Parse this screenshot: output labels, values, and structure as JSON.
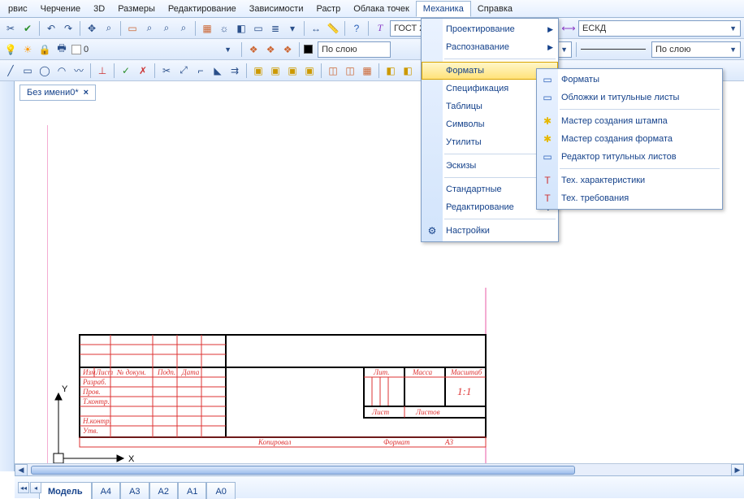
{
  "menu": {
    "items": [
      "рвис",
      "Черчение",
      "3D",
      "Размеры",
      "Редактирование",
      "Зависимости",
      "Растр",
      "Облака точек",
      "Механика",
      "Справка"
    ],
    "active_index": 8
  },
  "toolbar1": {
    "style_combo": "ГОСТ 2",
    "layer_combo": "ЕСКД"
  },
  "toolbar2": {
    "layer_combo": "По слою",
    "layer_combo2": "По слою",
    "line_label": "По слою",
    "yellow_label": "0"
  },
  "doc_tab": {
    "title": "Без имени0*"
  },
  "dropdown": {
    "items": [
      {
        "label": "Проектирование",
        "has_sub": true
      },
      {
        "label": "Распознавание",
        "has_sub": true
      },
      {
        "divider": true
      },
      {
        "label": "Форматы",
        "has_sub": true,
        "highlight": true
      },
      {
        "label": "Спецификация",
        "has_sub": true
      },
      {
        "label": "Таблицы",
        "has_sub": true
      },
      {
        "label": "Символы",
        "has_sub": true
      },
      {
        "label": "Утилиты",
        "has_sub": true
      },
      {
        "divider": true
      },
      {
        "label": "Эскизы",
        "has_sub": true
      },
      {
        "divider": true
      },
      {
        "label": "Стандартные",
        "has_sub": true
      },
      {
        "label": "Редактирование",
        "has_sub": true
      },
      {
        "divider": true
      },
      {
        "label": "Настройки",
        "icon": "⚙",
        "has_sub": false
      }
    ]
  },
  "submenu": {
    "items": [
      {
        "label": "Форматы",
        "icon": "▭"
      },
      {
        "label": "Обложки и титульные листы",
        "icon": "▭"
      },
      {
        "divider": true
      },
      {
        "label": "Мастер создания штампа",
        "icon": "✱"
      },
      {
        "label": "Мастер создания формата",
        "icon": "✱"
      },
      {
        "label": "Редактор титульных листов",
        "icon": "▭"
      },
      {
        "divider": true
      },
      {
        "label": "Тех. характеристики",
        "icon": "T"
      },
      {
        "label": "Тех. требования",
        "icon": "T"
      }
    ]
  },
  "title_block": {
    "head_row": [
      "Изм",
      "Лист",
      "№ докум.",
      "Подп.",
      "Дата"
    ],
    "left_rows": [
      "Разраб.",
      "Пров.",
      "Т.контр.",
      "",
      "Н.контр.",
      "Утв."
    ],
    "top_row": [
      "Лит.",
      "Масса",
      "Масштаб"
    ],
    "scale": "1:1",
    "mid_row": [
      "Лист",
      "Листов"
    ],
    "bottom_row": [
      "Копировал",
      "Формат",
      "A3"
    ]
  },
  "bottom_tabs": {
    "tabs": [
      "Модель",
      "A4",
      "A3",
      "A2",
      "A1",
      "A0"
    ],
    "active_index": 0
  },
  "axis": {
    "x": "X",
    "y": "Y"
  }
}
